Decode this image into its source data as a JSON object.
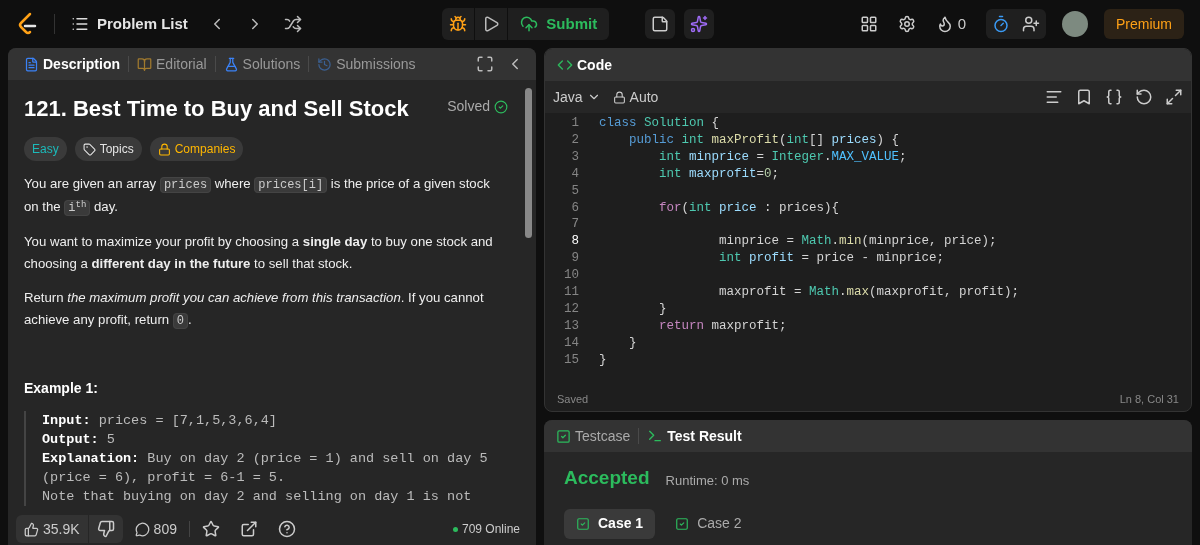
{
  "topbar": {
    "nav_title": "Problem List",
    "submit": "Submit",
    "streak": "0",
    "premium": "Premium"
  },
  "description_tabs": [
    {
      "label": "Description",
      "kind": "description",
      "selected": true
    },
    {
      "label": "Editorial",
      "kind": "editorial",
      "selected": false
    },
    {
      "label": "Solutions",
      "kind": "solutions",
      "selected": false
    },
    {
      "label": "Submissions",
      "kind": "submissions",
      "selected": false
    }
  ],
  "problem": {
    "title": "121. Best Time to Buy and Sell Stock",
    "status": "Solved",
    "solved": true,
    "tags": [
      {
        "label": "Easy",
        "kind": "difficulty"
      },
      {
        "label": "Topics",
        "kind": "topics"
      },
      {
        "label": "Companies",
        "kind": "companies"
      }
    ],
    "paragraphs": [
      [
        {
          "kind": "text",
          "text": "You are given an array "
        },
        {
          "kind": "code",
          "text": "prices"
        },
        {
          "kind": "text",
          "text": " where "
        },
        {
          "kind": "code",
          "text": "prices[i]"
        },
        {
          "kind": "text",
          "text": " is the price of a given stock on the "
        },
        {
          "kind": "code",
          "text": "i$^{th}$"
        },
        {
          "kind": "text",
          "text": " day."
        }
      ],
      [
        {
          "kind": "text",
          "text": "You want to maximize your profit by choosing a **single day** to buy one stock and choosing a **different day in the future** to sell that stock."
        }
      ],
      [
        {
          "kind": "text",
          "text": "Return *the maximum profit you can achieve from this transaction*. If you cannot achieve any profit, return "
        },
        {
          "kind": "code",
          "text": "0"
        },
        {
          "kind": "text",
          "text": "."
        }
      ]
    ],
    "example_title": "Example 1:",
    "example_lines": [
      {
        "label": "Input:",
        "value": "prices = [7,1,5,3,6,4]"
      },
      {
        "label": "Output:",
        "value": "5"
      },
      {
        "label": "Explanation:",
        "value": "Buy on day 2 (price = 1) and sell on day 5 (price = 6), profit = 6-1 = 5."
      },
      {
        "value": "Note that buying on day 2 and selling on day 1 is not"
      }
    ]
  },
  "footer": {
    "likes": "35.9K",
    "comments": "809",
    "online": "709 Online"
  },
  "code_panel": {
    "title": "Code",
    "language": "Java",
    "mode": "Auto",
    "status": "Saved",
    "cursor": "Ln 8, Col 31",
    "lines": [
      {
        "number": "1",
        "tokens": [
          {
            "kind": "keyword",
            "text": "class "
          },
          {
            "kind": "type",
            "text": "Solution"
          },
          {
            "kind": "plain",
            "text": " {"
          }
        ]
      },
      {
        "number": "2",
        "tokens": [
          {
            "kind": "keyword",
            "text": "    public "
          },
          {
            "kind": "type",
            "text": "int "
          },
          {
            "kind": "func",
            "text": "maxProfit"
          },
          {
            "kind": "plain",
            "text": "("
          },
          {
            "kind": "type",
            "text": "int"
          },
          {
            "kind": "plain",
            "text": "[] "
          },
          {
            "kind": "var",
            "text": "prices"
          },
          {
            "kind": "plain",
            "text": ") {"
          }
        ]
      },
      {
        "number": "3",
        "tokens": [
          {
            "kind": "type",
            "text": "        int "
          },
          {
            "kind": "var",
            "text": "minprice"
          },
          {
            "kind": "plain",
            "text": " = "
          },
          {
            "kind": "type",
            "text": "Integer"
          },
          {
            "kind": "plain",
            "text": "."
          },
          {
            "kind": "const",
            "text": "MAX_VALUE"
          },
          {
            "kind": "plain",
            "text": ";"
          }
        ]
      },
      {
        "number": "4",
        "tokens": [
          {
            "kind": "type",
            "text": "        int "
          },
          {
            "kind": "var",
            "text": "maxprofit"
          },
          {
            "kind": "plain",
            "text": "="
          },
          {
            "kind": "number",
            "text": "0"
          },
          {
            "kind": "plain",
            "text": ";"
          }
        ]
      },
      {
        "number": "5"
      },
      {
        "number": "6",
        "tokens": [
          {
            "kind": "control",
            "text": "        for"
          },
          {
            "kind": "plain",
            "text": "("
          },
          {
            "kind": "type",
            "text": "int "
          },
          {
            "kind": "var",
            "text": "price"
          },
          {
            "kind": "plain",
            "text": " : prices){"
          }
        ]
      },
      {
        "number": "7"
      },
      {
        "number": "8",
        "tokens": [
          {
            "kind": "plain",
            "text": "                minprice = "
          },
          {
            "kind": "type",
            "text": "Math"
          },
          {
            "kind": "plain",
            "text": "."
          },
          {
            "kind": "func",
            "text": "min"
          },
          {
            "kind": "plain",
            "text": "(minprice, price);"
          }
        ]
      },
      {
        "number": "9",
        "tokens": [
          {
            "kind": "type",
            "text": "                int "
          },
          {
            "kind": "var",
            "text": "profit"
          },
          {
            "kind": "plain",
            "text": " = price - minprice;"
          }
        ]
      },
      {
        "number": "10"
      },
      {
        "number": "11",
        "tokens": [
          {
            "kind": "plain",
            "text": "                maxprofit = "
          },
          {
            "kind": "type",
            "text": "Math"
          },
          {
            "kind": "plain",
            "text": "."
          },
          {
            "kind": "func",
            "text": "max"
          },
          {
            "kind": "plain",
            "text": "(maxprofit, profit);"
          }
        ]
      },
      {
        "number": "12",
        "tokens": [
          {
            "kind": "plain",
            "text": "        }"
          }
        ]
      },
      {
        "number": "13",
        "tokens": [
          {
            "kind": "control",
            "text": "        return"
          },
          {
            "kind": "plain",
            "text": " maxprofit;"
          }
        ]
      },
      {
        "number": "14",
        "tokens": [
          {
            "kind": "plain",
            "text": "    }"
          }
        ]
      },
      {
        "number": "15",
        "tokens": [
          {
            "kind": "plain",
            "text": "}"
          }
        ]
      }
    ]
  },
  "test_panel": {
    "tabs": [
      {
        "label": "Testcase",
        "kind": "testcase",
        "selected": false
      },
      {
        "label": "Test Result",
        "kind": "result",
        "selected": true
      }
    ],
    "verdict": "Accepted",
    "runtime": "Runtime: 0 ms",
    "cases": [
      {
        "label": "Case 1",
        "selected": true
      },
      {
        "label": "Case 2",
        "selected": false
      }
    ]
  }
}
